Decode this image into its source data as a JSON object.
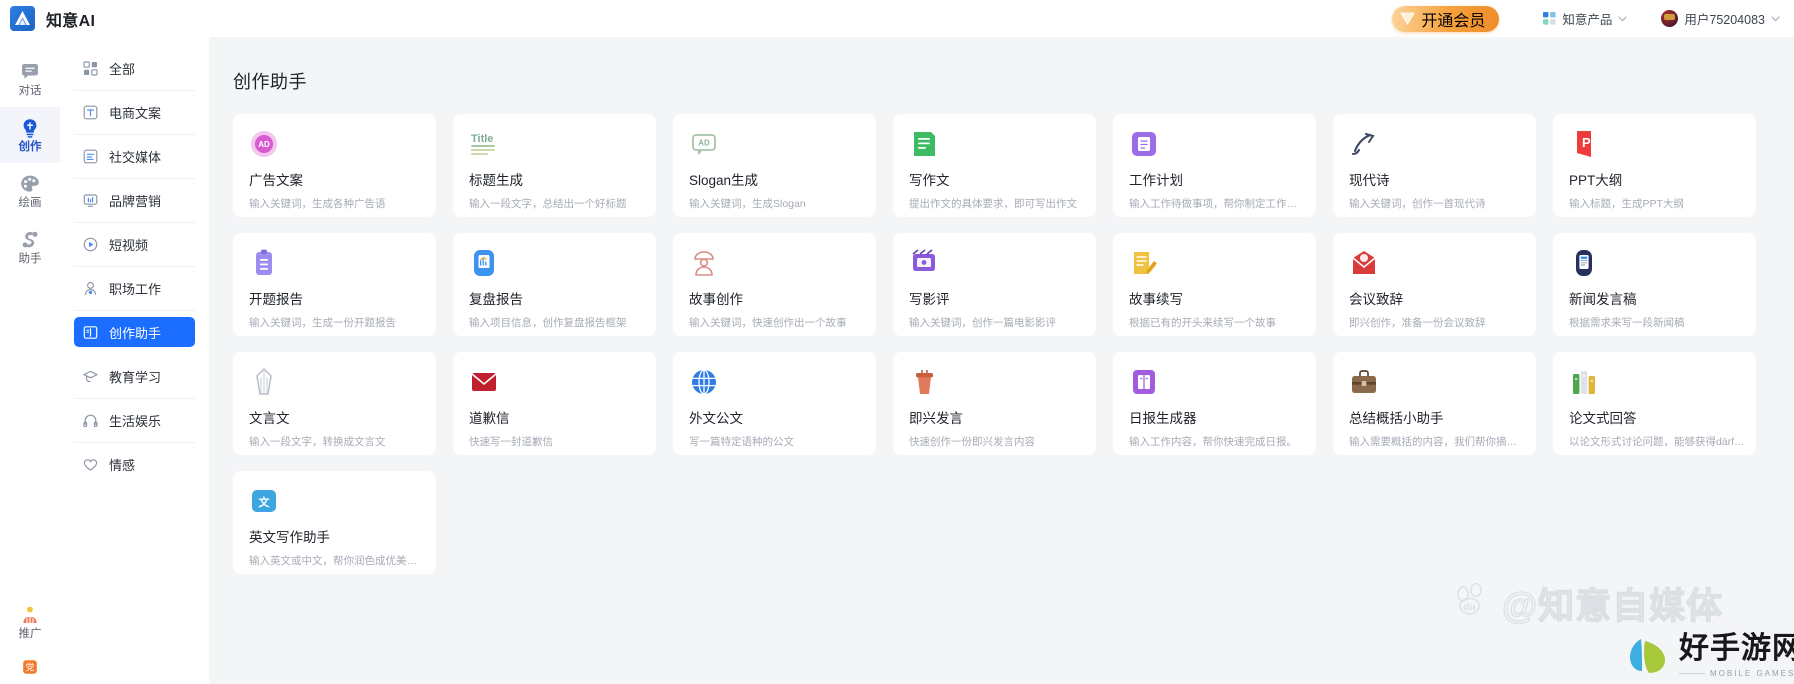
{
  "header": {
    "brand_name": "知意AI",
    "logo_icon": "mountain-logo-icon",
    "vip_label": "开通会员",
    "vip_icon": "gem-icon",
    "products_label": "知意产品",
    "products_icon": "grid-mini-icon",
    "products_caret_icon": "chevron-down-icon",
    "user_label": "用户75204083",
    "user_avatar_icon": "avatar-icon",
    "user_caret_icon": "chevron-down-icon",
    "accent_blue": "#1a6dff",
    "vip_gold": "#f5a03c"
  },
  "rail": {
    "items": [
      {
        "label": "对话",
        "icon": "chat-bubble-icon",
        "active": false
      },
      {
        "label": "创作",
        "icon": "lightbulb-icon",
        "active": true
      },
      {
        "label": "绘画",
        "icon": "palette-icon",
        "active": false
      },
      {
        "label": "助手",
        "icon": "assistant-swirl-icon",
        "active": false
      }
    ],
    "bottom_items": [
      {
        "label": "推广",
        "icon": "promote-people-icon",
        "active": false
      },
      {
        "label": "",
        "icon": "party-badge-icon",
        "active": false
      }
    ]
  },
  "categories": {
    "items": [
      {
        "label": "全部",
        "icon": "grid-all-icon",
        "active": false
      },
      {
        "label": "电商文案",
        "icon": "text-t-icon",
        "active": false
      },
      {
        "label": "社交媒体",
        "icon": "lines-doc-icon",
        "active": false
      },
      {
        "label": "品牌营销",
        "icon": "monitor-chart-icon",
        "active": false
      },
      {
        "label": "短视频",
        "icon": "play-circle-icon",
        "active": false
      },
      {
        "label": "职场工作",
        "icon": "person-icon",
        "active": false
      },
      {
        "label": "创作助手",
        "icon": "open-book-icon",
        "active": true
      },
      {
        "label": "教育学习",
        "icon": "graduation-cap-icon",
        "active": false
      },
      {
        "label": "生活娱乐",
        "icon": "headphone-icon",
        "active": false
      },
      {
        "label": "情感",
        "icon": "heart-icon",
        "active": false
      }
    ]
  },
  "main": {
    "section_title": "创作助手",
    "cards": [
      {
        "title": "广告文案",
        "desc": "输入关键词，生成各种广告语",
        "icon": "ad-circle-icon",
        "c1": "#e86ed8",
        "c2": "#c45ae0"
      },
      {
        "title": "标题生成",
        "desc": "输入一段文字，总结出一个好标题",
        "icon": "title-lines-icon",
        "c1": "#7fae93",
        "c2": "#cfd8a8"
      },
      {
        "title": "Slogan生成",
        "desc": "输入关键词，生成Slogan",
        "icon": "ad-tag-icon",
        "c1": "#b9cfb4",
        "c2": "#8fb49a"
      },
      {
        "title": "写作文",
        "desc": "提出作文的具体要求，即可写出作文",
        "icon": "green-doc-icon",
        "c1": "#3dbb63",
        "c2": "#2ea154"
      },
      {
        "title": "工作计划",
        "desc": "输入工作待做事项，帮你制定工作计划",
        "icon": "purple-plan-icon",
        "c1": "#9b6ee8",
        "c2": "#7f4fd8"
      },
      {
        "title": "现代诗",
        "desc": "输入关键词，创作一首现代诗",
        "icon": "poem-brush-icon",
        "c1": "#4b5a78",
        "c2": "#2f3c55"
      },
      {
        "title": "PPT大纲",
        "desc": "输入标题，生成PPT大纲",
        "icon": "ppt-red-icon",
        "c1": "#ee3b3b",
        "c2": "#cc2626"
      },
      {
        "title": "开题报告",
        "desc": "输入关键词，生成一份开题报告",
        "icon": "clipboard-purple-icon",
        "c1": "#9b8ef0",
        "c2": "#7d6ee6"
      },
      {
        "title": "复盘报告",
        "desc": "输入项目信息，创作复盘报告框架",
        "icon": "chart-blue-icon",
        "c1": "#3d94f0",
        "c2": "#1f74dd"
      },
      {
        "title": "故事创作",
        "desc": "输入关键词，快速创作出一个故事",
        "icon": "storyteller-icon",
        "c1": "#e8a7a0",
        "c2": "#d98d86"
      },
      {
        "title": "写影评",
        "desc": "输入关键词，创作一篇电影影评",
        "icon": "film-review-icon",
        "c1": "#8a5ad8",
        "c2": "#5d3fb0"
      },
      {
        "title": "故事续写",
        "desc": "根据已有的开头来续写一个故事",
        "icon": "pencil-doc-icon",
        "c1": "#f0c23d",
        "c2": "#e0a41f"
      },
      {
        "title": "会议致辞",
        "desc": "即兴创作，准备一份会议致辞",
        "icon": "envelope-red-icon",
        "c1": "#d93b3b",
        "c2": "#b22222"
      },
      {
        "title": "新闻发言稿",
        "desc": "根据需求来写一段新闻稿",
        "icon": "news-phone-icon",
        "c1": "#26315e",
        "c2": "#151c3a"
      },
      {
        "title": "文言文",
        "desc": "输入一段文字，转换成文言文",
        "icon": "scholar-robe-icon",
        "c1": "#c9cdd6",
        "c2": "#aab0bc"
      },
      {
        "title": "道歉信",
        "desc": "快速写一封道歉信",
        "icon": "envelope-crimson-icon",
        "c1": "#c01f2e",
        "c2": "#9a1824"
      },
      {
        "title": "外文公文",
        "desc": "写一篇特定语种的公文",
        "icon": "globe-blue-icon",
        "c1": "#2f7ee8",
        "c2": "#1c5ec0"
      },
      {
        "title": "即兴发言",
        "desc": "快速创作一份即兴发言内容",
        "icon": "podium-icon",
        "c1": "#e07a5a",
        "c2": "#b85a3a"
      },
      {
        "title": "日报生成器",
        "desc": "输入工作内容，帮你快速完成日报。",
        "icon": "book-violet-icon",
        "c1": "#a25ce0",
        "c2": "#7f3cc0"
      },
      {
        "title": "总结概括小助手",
        "desc": "输入需要概括的内容，我们帮你摘简…",
        "icon": "briefcase-icon",
        "c1": "#8a6a4a",
        "c2": "#5e4630"
      },
      {
        "title": "论文式回答",
        "desc": "以论文形式讨论问题，能够获得därf连贯…",
        "icon": "books-icon",
        "c1": "#4da84d",
        "c2": "#e0b63a"
      },
      {
        "title": "英文写作助手",
        "desc": "输入英文或中文，帮你润色成优美的…",
        "icon": "translate-icon",
        "c1": "#3da5e0",
        "c2": "#1f80c0"
      }
    ]
  },
  "watermarks": {
    "baidu_text": "@知意自媒体",
    "baidu_icon": "baidu-paw-icon",
    "brand_cn": "好手游网",
    "brand_en": "MOBILE GAMES",
    "brand_icon": "leaf-mark-icon"
  }
}
